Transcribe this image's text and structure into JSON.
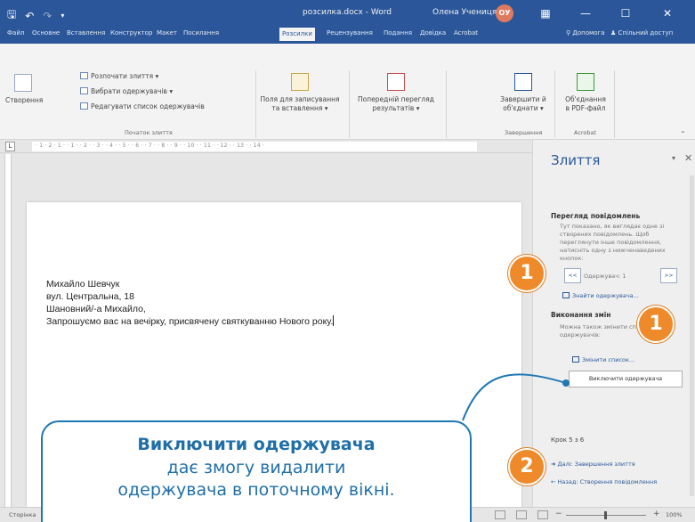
{
  "titlebar": {
    "document": "розсилка.docx - Word",
    "user": "Олена Учениця",
    "avatar": "ОУ",
    "minimize": "—",
    "restore": "☐",
    "close": "✕"
  },
  "tabs": [
    "Файл",
    "Основне",
    "Вставлення",
    "Конструктор",
    "Макет",
    "Посилання",
    "Розсилки",
    "Рецензування",
    "Подання",
    "Довідка",
    "Acrobat"
  ],
  "tabs_active": "Розсилки",
  "tabs_right": {
    "help": "Допомога",
    "share": "Спільний доступ"
  },
  "ribbon": {
    "create": "Створення",
    "start_merge": "Розпочати злиття",
    "select_recipients": "Вибрати одержувачів",
    "edit_list": "Редагувати список одержувачів",
    "group_start": "Початок злиття",
    "fields_line1": "Поля для записування",
    "fields_line2": "та вставлення",
    "preview_line1": "Попередній перегляд",
    "preview_line2": "результатів",
    "finish_line1": "Завершити й",
    "finish_line2": "об'єднати",
    "group_finish": "Завершення",
    "pdf_line1": "Об'єднання",
    "pdf_line2": "в PDF-файл",
    "group_acrobat": "Acrobat"
  },
  "ruler": {
    "tab_selector": "L",
    "numbers": "· 1 · 2 · 1 · · 1 · · 2 · · 3 · · 4 · · 5 · · 6 · · 7 · · 8 · · 9 · · 10 · · 11 · · 12 · · 13 · · 14 ·"
  },
  "letter": {
    "line1": "Михайло Шевчук",
    "line2": "вул. Центральна, 18",
    "line3": "Шановний/-а Михайло,",
    "line4": "Запрошуємо вас на вечірку, присвячену святкуванню Нового року."
  },
  "pane": {
    "title": "Злиття",
    "preview_heading": "Перегляд повідомлень",
    "preview_desc": "Тут показано, як виглядає одне зі створених повідомлень. Щоб переглянути інше повідомлення, натисніть одну з нижченаведених кнопок:",
    "prev_btn": "<<",
    "next_btn": ">>",
    "recipient": "Одержувач: 1",
    "find_recipient": "Знайти одержувача...",
    "changes_heading": "Виконання змін",
    "changes_desc": "Можна також змінити список одержувачів:",
    "edit_list": "Змінити список...",
    "exclude": "Виключити одержувача",
    "steps": "Крок 5 з 6",
    "next_step": "Далі: Завершення злиття",
    "prev_step": "Назад: Створення повідомлення"
  },
  "status": {
    "page": "Сторінка",
    "zoom": "100%",
    "zoom_minus": "−",
    "zoom_plus": "+"
  },
  "annotations": {
    "badge1": "1",
    "badge2": "2",
    "callout_title": "Виключити одержувача",
    "callout_line2": "дає змогу видалити",
    "callout_line3": "одержувача в поточному вікні."
  },
  "colors": {
    "word_blue": "#2b579a",
    "badge_orange": "#ef8a2b",
    "callout_blue": "#1f6fa8"
  }
}
